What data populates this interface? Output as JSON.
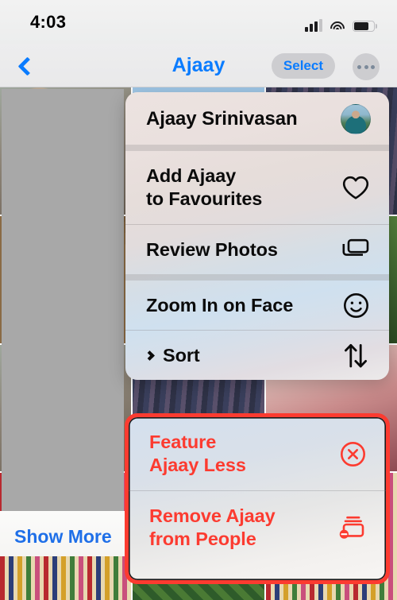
{
  "status_bar": {
    "time": "4:03",
    "cellular_icon": "cellular-bars-icon",
    "wifi_icon": "wifi-icon",
    "battery_icon": "battery-icon"
  },
  "nav_bar": {
    "back_icon": "chevron-left-icon",
    "title": "Ajaay",
    "select_label": "Select",
    "more_icon": "ellipsis-icon"
  },
  "background": {
    "show_more_label": "Show More"
  },
  "context_menu": {
    "items": [
      {
        "label": "Ajaay Srinivasan",
        "icon": "avatar-photo",
        "destructive": false
      },
      {
        "label": "Add Ajaay\nto Favourites",
        "icon": "heart-icon",
        "destructive": false
      },
      {
        "label": "Review Photos",
        "icon": "rectangle-stack-icon",
        "destructive": false
      },
      {
        "label": "Zoom In on Face",
        "icon": "smiley-face-icon",
        "destructive": false
      },
      {
        "label": "Sort",
        "icon": "arrow-up-arrow-down-icon",
        "submenu_icon": "chevron-right-icon",
        "destructive": false
      }
    ],
    "destructive_items": [
      {
        "label": "Feature\nAjaay Less",
        "icon": "xmark-circle-icon",
        "destructive": true
      },
      {
        "label": "Remove Ajaay\nfrom People",
        "icon": "rectangle-stack-badge-minus-icon",
        "destructive": true
      }
    ]
  },
  "colors": {
    "accent_blue": "#0a7cff",
    "destructive_red": "#fc3b30",
    "highlight_outline": "#fc3b30",
    "redacted_gray": "#a8a8a8"
  }
}
